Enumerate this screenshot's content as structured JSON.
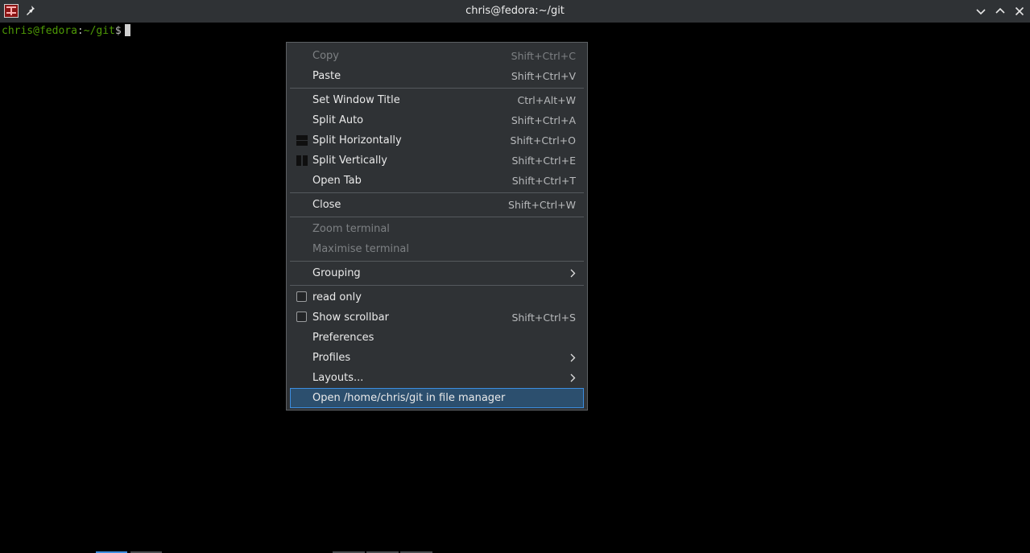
{
  "window": {
    "title": "chris@fedora:~/git",
    "icons": [
      "terminator-app-icon",
      "pin-icon",
      "minimize-icon",
      "maximize-icon",
      "close-icon"
    ]
  },
  "terminal": {
    "prompt_user": "chris@fedora",
    "prompt_sep": ":",
    "prompt_path": "~/git",
    "prompt_dollar": "$"
  },
  "menu": {
    "copy": {
      "label": "Copy",
      "shortcut": "Shift+Ctrl+C"
    },
    "paste": {
      "label": "Paste",
      "shortcut": "Shift+Ctrl+V"
    },
    "set_title": {
      "label": "Set Window Title",
      "shortcut": "Ctrl+Alt+W"
    },
    "split_auto": {
      "label": "Split Auto",
      "shortcut": "Shift+Ctrl+A"
    },
    "split_h": {
      "label": "Split Horizontally",
      "shortcut": "Shift+Ctrl+O"
    },
    "split_v": {
      "label": "Split Vertically",
      "shortcut": "Shift+Ctrl+E"
    },
    "open_tab": {
      "label": "Open Tab",
      "shortcut": "Shift+Ctrl+T"
    },
    "close": {
      "label": "Close",
      "shortcut": "Shift+Ctrl+W"
    },
    "zoom": {
      "label": "Zoom terminal"
    },
    "maximise": {
      "label": "Maximise terminal"
    },
    "grouping": {
      "label": "Grouping"
    },
    "read_only": {
      "label": "read only",
      "checked": false
    },
    "show_scrollbar": {
      "label": "Show scrollbar",
      "shortcut": "Shift+Ctrl+S",
      "checked": false
    },
    "preferences": {
      "label": "Preferences"
    },
    "profiles": {
      "label": "Profiles"
    },
    "layouts": {
      "label": "Layouts..."
    },
    "open_fm": {
      "label": "Open /home/chris/git in file manager"
    }
  },
  "colors": {
    "terminal_bg": "#000000",
    "prompt_green": "#4e9a06",
    "menu_bg": "#2f3235",
    "highlight_bg": "#2c4f6e",
    "highlight_border": "#3d8ee0"
  }
}
